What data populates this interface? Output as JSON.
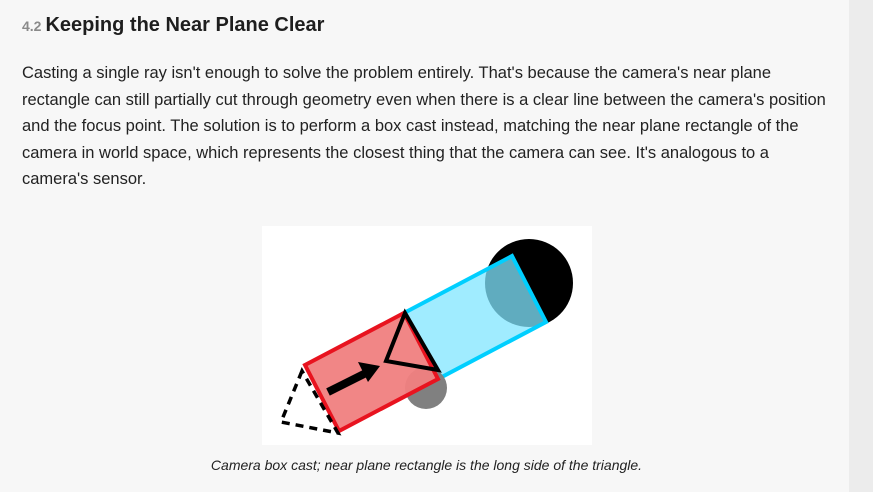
{
  "section": {
    "number": "4.2",
    "title": "Keeping the Near Plane Clear"
  },
  "paragraph": "Casting a single ray isn't enough to solve the problem entirely. That's because the camera's near plane rectangle can still partially cut through geometry even when there is a clear line between the camera's position and the focus point. The solution is to perform a box cast instead, matching the near plane rectangle of the camera in world space, which represents the closest thing that the camera can see. It's analogous to a camera's sensor.",
  "figure": {
    "caption": "Camera box cast; near plane rectangle is the long side of the triangle.",
    "colors": {
      "box_cast_red": "#e8131f",
      "box_cast_red_fill": "#f08080",
      "box_cast_cyan": "#00cfff",
      "box_cast_cyan_fill": "#80e6ff",
      "obstacle": "#000000",
      "focus_point": "#808080"
    }
  }
}
